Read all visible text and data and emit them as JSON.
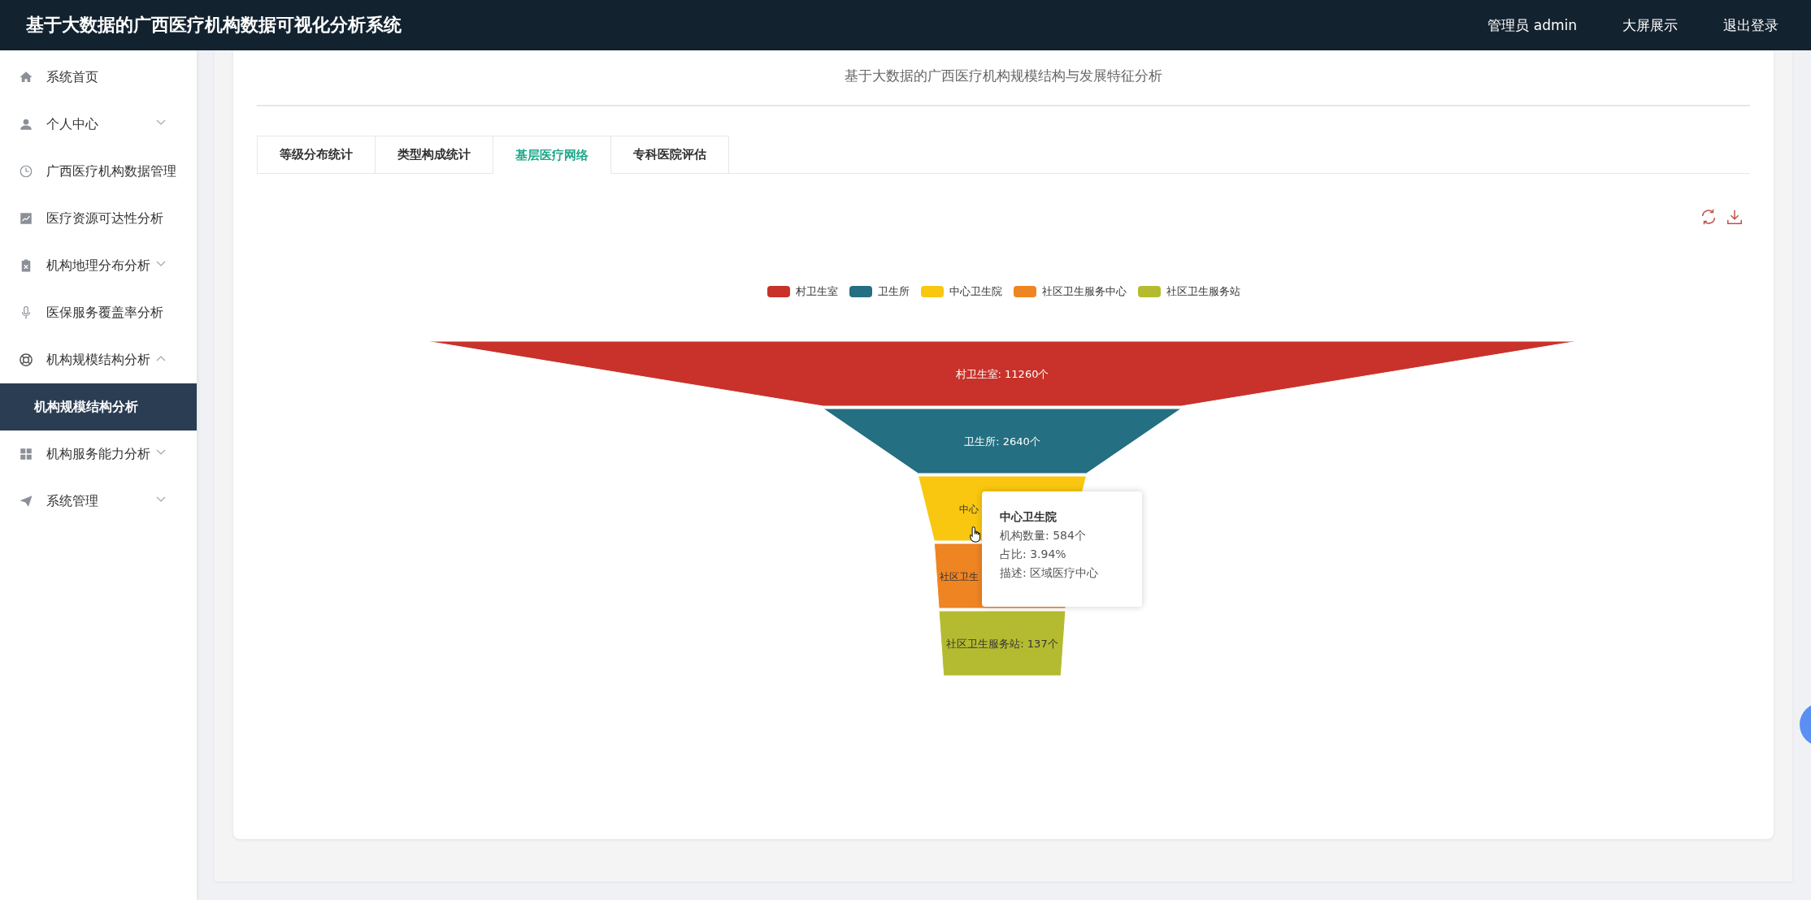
{
  "header": {
    "title": "基于大数据的广西医疗机构数据可视化分析系统",
    "user": "管理员 admin",
    "links": [
      "大屏展示",
      "退出登录"
    ]
  },
  "sidebar": {
    "items": [
      {
        "label": "系统首页"
      },
      {
        "label": "个人中心",
        "expanded": false
      },
      {
        "label": "广西医疗机构数据管理"
      },
      {
        "label": "医疗资源可达性分析"
      },
      {
        "label": "机构地理分布分析",
        "expanded": false
      },
      {
        "label": "医保服务覆盖率分析"
      },
      {
        "label": "机构规模结构分析",
        "expanded": true,
        "children": [
          {
            "label": "机构规模结构分析",
            "selected": true
          }
        ]
      },
      {
        "label": "机构服务能力分析",
        "expanded": false
      },
      {
        "label": "系统管理",
        "expanded": false
      }
    ]
  },
  "page": {
    "title": "基于大数据的广西医疗机构规模结构与发展特征分析",
    "tabs": [
      {
        "label": "等级分布统计",
        "selected": false
      },
      {
        "label": "类型构成统计",
        "selected": false
      },
      {
        "label": "基层医疗网络",
        "selected": true
      },
      {
        "label": "专科医院评估",
        "selected": false
      }
    ],
    "chart": {
      "legend": [
        {
          "label": "村卫生室",
          "color": "#c8322a"
        },
        {
          "label": "卫生所",
          "color": "#246f81"
        },
        {
          "label": "中心卫生院",
          "color": "#f9c710"
        },
        {
          "label": "社区卫生服务中心",
          "color": "#ef8423"
        },
        {
          "label": "社区卫生服务站",
          "color": "#b5bb30"
        }
      ],
      "segments": [
        {
          "label": "村卫生室: 11260个",
          "covered": false
        },
        {
          "label": "卫生所: 2640个",
          "covered": false
        },
        {
          "label": "中心",
          "covered": true
        },
        {
          "label": "社区卫生",
          "covered": true
        },
        {
          "label": "社区卫生服务站: 137个",
          "covered": false
        }
      ],
      "tooltip": {
        "title": "中心卫生院",
        "lines": [
          "机构数量: 584个",
          "占比: 3.94%",
          "描述: 区域医疗中心"
        ]
      }
    }
  }
}
